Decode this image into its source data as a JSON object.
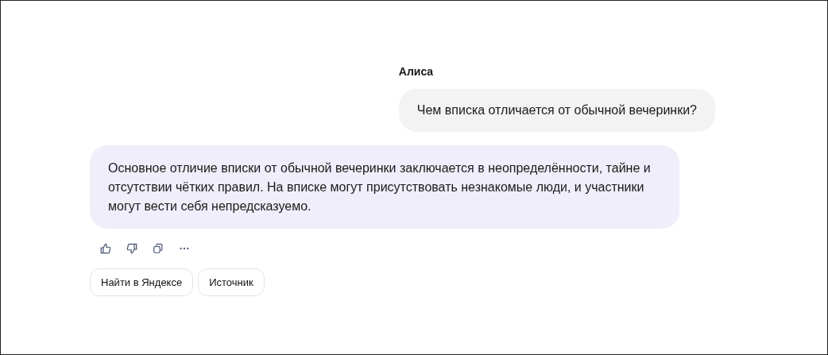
{
  "messages": [
    {
      "kind": "user",
      "author": "Алиса",
      "text": "Чем вписка отличается от обычной вечеринки?"
    },
    {
      "kind": "assistant",
      "text": "Основное отличие вписки от обычной вечеринки заключается в неопределённости, тайне и отсутствии чётких правил. На вписке могут присутствовать незнакомые люди, и участники могут вести себя непредсказуемо."
    }
  ],
  "actions": [
    {
      "kind": "like"
    },
    {
      "kind": "dislike"
    },
    {
      "kind": "copy"
    },
    {
      "kind": "more"
    }
  ],
  "suggestions": [
    "Найти в Яндексе",
    "Источник"
  ]
}
